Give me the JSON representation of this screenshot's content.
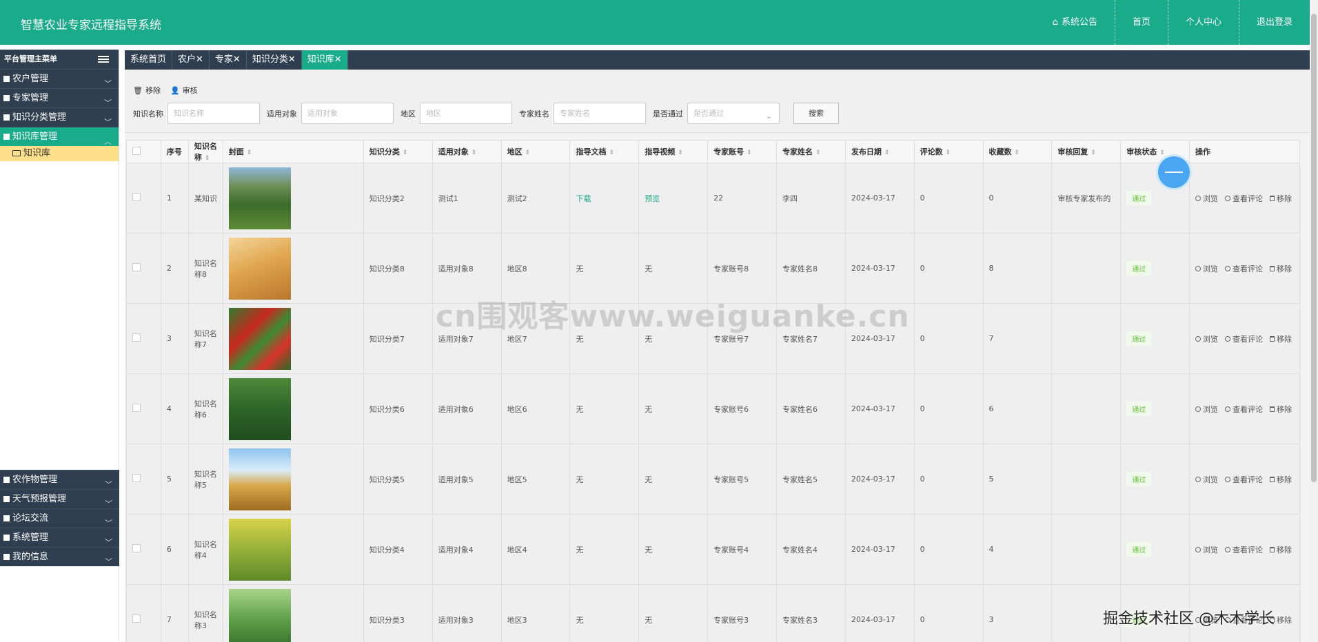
{
  "header": {
    "title": "智慧农业专家远程指导系统",
    "nav": [
      {
        "label": "系统公告",
        "icon": "home-icon"
      },
      {
        "label": "首页"
      },
      {
        "label": "个人中心"
      },
      {
        "label": "退出登录"
      }
    ]
  },
  "sidebar": {
    "title": "平台管理主菜单",
    "items": [
      {
        "label": "农户管理"
      },
      {
        "label": "专家管理"
      },
      {
        "label": "知识分类管理"
      },
      {
        "label": "知识库管理",
        "active": true
      }
    ],
    "sub_items": [
      {
        "label": "知识库"
      }
    ],
    "lower_items": [
      {
        "label": "农作物管理"
      },
      {
        "label": "天气预报管理"
      },
      {
        "label": "论坛交流"
      },
      {
        "label": "系统管理"
      },
      {
        "label": "我的信息"
      }
    ]
  },
  "tabs": [
    {
      "label": "系统首页"
    },
    {
      "label": "农户✕"
    },
    {
      "label": "专家✕"
    },
    {
      "label": "知识分类✕"
    },
    {
      "label": "知识库✕",
      "active": true
    }
  ],
  "toolbar": {
    "remove_label": "移除",
    "audit_label": "审核"
  },
  "search": {
    "name_label": "知识名称",
    "name_placeholder": "知识名称",
    "target_label": "适用对象",
    "target_placeholder": "适用对象",
    "region_label": "地区",
    "region_placeholder": "地区",
    "expert_label": "专家姓名",
    "expert_placeholder": "专家姓名",
    "pass_label": "是否通过",
    "pass_placeholder": "是否通过",
    "search_button": "搜索"
  },
  "table": {
    "headers": [
      "序号",
      "知识名称",
      "封面",
      "知识分类",
      "适用对象",
      "地区",
      "指导文档",
      "指导视频",
      "专家账号",
      "专家姓名",
      "发布日期",
      "评论数",
      "收藏数",
      "审核回复",
      "审核状态",
      "操作"
    ],
    "ops": [
      "浏览",
      "查看评论",
      "移除"
    ],
    "rows": [
      {
        "no": "1",
        "name": "某知识",
        "cover": "millet",
        "category": "知识分类2",
        "target": "测试1",
        "region": "测试2",
        "doc": "下载",
        "video": "预览",
        "account": "22",
        "expert": "李四",
        "date": "2024-03-17",
        "comments": "0",
        "favorites": "0",
        "reply": "审核专家发布的",
        "status": "通过"
      },
      {
        "no": "2",
        "name": "知识名称8",
        "cover": "wheat",
        "category": "知识分类8",
        "target": "适用对象8",
        "region": "地区8",
        "doc": "无",
        "video": "无",
        "account": "专家账号8",
        "expert": "专家姓名8",
        "date": "2024-03-17",
        "comments": "0",
        "favorites": "8",
        "reply": "",
        "status": "通过"
      },
      {
        "no": "3",
        "name": "知识名称7",
        "cover": "peppers",
        "category": "知识分类7",
        "target": "适用对象7",
        "region": "地区7",
        "doc": "无",
        "video": "无",
        "account": "专家账号7",
        "expert": "专家姓名7",
        "date": "2024-03-17",
        "comments": "0",
        "favorites": "7",
        "reply": "",
        "status": "通过"
      },
      {
        "no": "4",
        "name": "知识名称6",
        "cover": "soybean",
        "category": "知识分类6",
        "target": "适用对象6",
        "region": "地区6",
        "doc": "无",
        "video": "无",
        "account": "专家账号6",
        "expert": "专家姓名6",
        "date": "2024-03-17",
        "comments": "0",
        "favorites": "6",
        "reply": "",
        "status": "通过"
      },
      {
        "no": "5",
        "name": "知识名称5",
        "cover": "grain-sky",
        "category": "知识分类5",
        "target": "适用对象5",
        "region": "地区5",
        "doc": "无",
        "video": "无",
        "account": "专家账号5",
        "expert": "专家姓名5",
        "date": "2024-03-17",
        "comments": "0",
        "favorites": "5",
        "reply": "",
        "status": "通过"
      },
      {
        "no": "6",
        "name": "知识名称4",
        "cover": "rice",
        "category": "知识分类4",
        "target": "适用对象4",
        "region": "地区4",
        "doc": "无",
        "video": "无",
        "account": "专家账号4",
        "expert": "专家姓名4",
        "date": "2024-03-17",
        "comments": "0",
        "favorites": "4",
        "reply": "",
        "status": "通过"
      },
      {
        "no": "7",
        "name": "知识名称3",
        "cover": "peas",
        "category": "知识分类3",
        "target": "适用对象3",
        "region": "地区3",
        "doc": "无",
        "video": "无",
        "account": "专家账号3",
        "expert": "专家姓名3",
        "date": "2024-03-17",
        "comments": "0",
        "favorites": "3",
        "reply": "",
        "status": "通过"
      }
    ]
  },
  "watermarks": {
    "center": "cn围观客www.weiguanke.cn",
    "corner": "掘金技术社区 @木木学长"
  },
  "colors": {
    "brand": "#1aab8a",
    "sidebar": "#2f3f4f",
    "pass_green": "#67c23a"
  }
}
